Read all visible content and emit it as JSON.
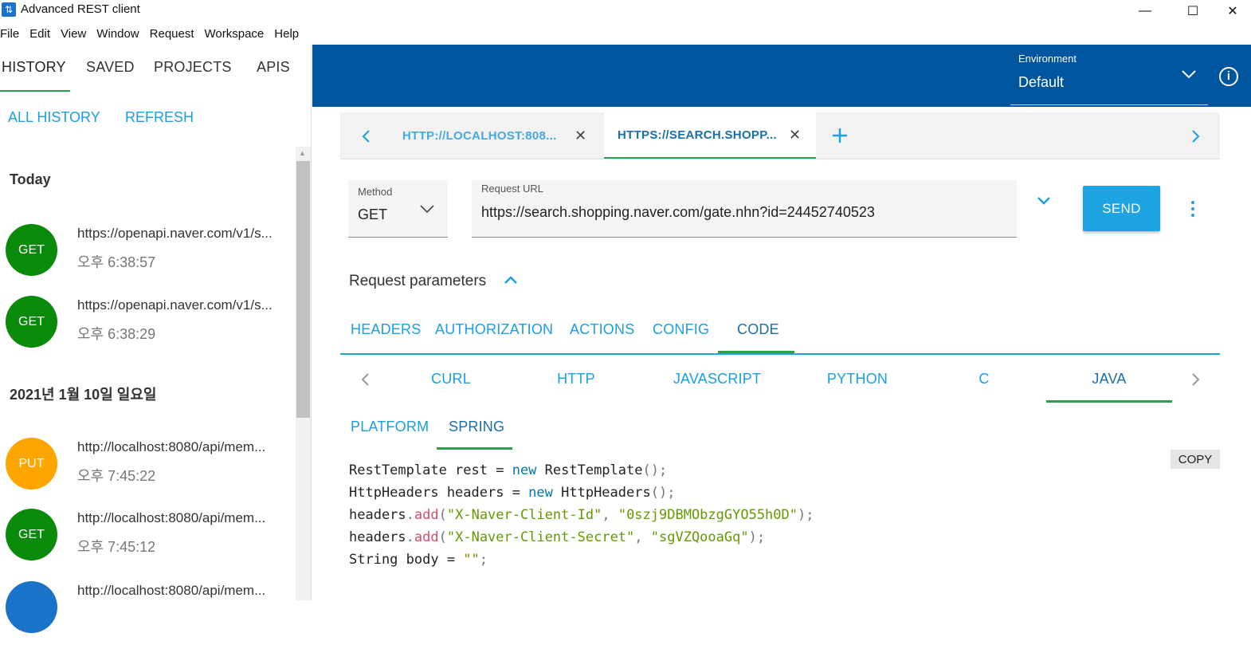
{
  "window": {
    "title": "Advanced REST client",
    "minimize": "—",
    "maximize": "☐",
    "close": "✕"
  },
  "menu": [
    "File",
    "Edit",
    "View",
    "Window",
    "Request",
    "Workspace",
    "Help"
  ],
  "sidebar": {
    "tabs": [
      "HISTORY",
      "SAVED",
      "PROJECTS",
      "APIS"
    ],
    "active_tab": "HISTORY",
    "actions": [
      "ALL HISTORY",
      "REFRESH"
    ],
    "groups": [
      {
        "header": "Today",
        "items": [
          {
            "method": "GET",
            "color": "#0a8a0a",
            "url": "https://openapi.naver.com/v1/s...",
            "time": "오후 6:38:57"
          },
          {
            "method": "GET",
            "color": "#0a8a0a",
            "url": "https://openapi.naver.com/v1/s...",
            "time": "오후 6:38:29"
          }
        ]
      },
      {
        "header": "2021년 1월 10일 일요일",
        "items": [
          {
            "method": "PUT",
            "color": "#ffa500",
            "url": "http://localhost:8080/api/mem...",
            "time": "오후 7:45:22"
          },
          {
            "method": "GET",
            "color": "#0a8a0a",
            "url": "http://localhost:8080/api/mem...",
            "time": "오후 7:45:12"
          },
          {
            "method": "",
            "color": "#1a73c8",
            "url": "http://localhost:8080/api/mem...",
            "time": ""
          }
        ]
      }
    ]
  },
  "environment": {
    "label": "Environment",
    "value": "Default"
  },
  "request_tabs": [
    {
      "label": "HTTP://LOCALHOST:808...",
      "active": false
    },
    {
      "label": "HTTPS://SEARCH.SHOPP...",
      "active": true
    }
  ],
  "request": {
    "method_label": "Method",
    "method": "GET",
    "url_label": "Request URL",
    "url": "https://search.shopping.naver.com/gate.nhn?id=24452740523",
    "send_label": "SEND"
  },
  "params": {
    "title": "Request parameters",
    "tabs": [
      "HEADERS",
      "AUTHORIZATION",
      "ACTIONS",
      "CONFIG",
      "CODE"
    ],
    "active_tab": "CODE",
    "lang_tabs": [
      "CURL",
      "HTTP",
      "JAVASCRIPT",
      "PYTHON",
      "C",
      "JAVA"
    ],
    "active_lang": "JAVA",
    "sub_tabs": [
      "PLATFORM",
      "SPRING"
    ],
    "active_sub": "SPRING",
    "copy_label": "COPY",
    "code_lines": {
      "l1a": "RestTemplate rest = ",
      "l1b": "new",
      "l1c": " RestTemplate",
      "l1d": "();",
      "l2a": "HttpHeaders headers = ",
      "l2b": "new",
      "l2c": " HttpHeaders",
      "l2d": "();",
      "l3a": "headers",
      "l3b": ".",
      "l3c": "add",
      "l3d": "(",
      "l3e": "\"X-Naver-Client-Id\"",
      "l3f": ", ",
      "l3g": "\"0szj9DBMObzgGYO55h0D\"",
      "l3h": ");",
      "l4a": "headers",
      "l4b": ".",
      "l4c": "add",
      "l4d": "(",
      "l4e": "\"X-Naver-Client-Secret\"",
      "l4f": ", ",
      "l4g": "\"sgVZQooaGq\"",
      "l4h": ");",
      "l5a": "String body = ",
      "l5b": "\"\"",
      "l5c": ";"
    }
  }
}
